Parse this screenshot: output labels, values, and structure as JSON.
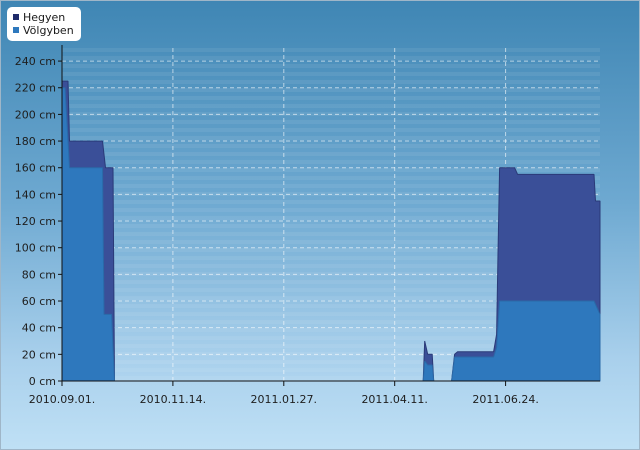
{
  "chart_data": {
    "type": "area",
    "x_ticks": [
      "2010.09.01.",
      "2010.11.14.",
      "2011.01.27.",
      "2011.04.11.",
      "2011.06.24."
    ],
    "y_ticks": [
      "0 cm",
      "20 cm",
      "40 cm",
      "60 cm",
      "80 cm",
      "100 cm",
      "120 cm",
      "140 cm",
      "160 cm",
      "180 cm",
      "200 cm",
      "220 cm",
      "240 cm"
    ],
    "ylim": [
      0,
      240
    ],
    "xlim": [
      "2010.09.01.",
      "2011.08.26."
    ],
    "legend_position": "top-left",
    "grid": true,
    "series": [
      {
        "name": "Hegyen",
        "color": "#3a4f98",
        "points": [
          [
            "2010.09.01.",
            225
          ],
          [
            "2010.09.05.",
            225
          ],
          [
            "2010.09.06.",
            180
          ],
          [
            "2010.09.28.",
            180
          ],
          [
            "2010.09.30.",
            160
          ],
          [
            "2010.10.05.",
            160
          ],
          [
            "2010.10.06.",
            0
          ],
          [
            "2011.04.30.",
            0
          ],
          [
            "2011.05.01.",
            30
          ],
          [
            "2011.05.03.",
            20
          ],
          [
            "2011.05.06.",
            20
          ],
          [
            "2011.05.07.",
            0
          ],
          [
            "2011.05.19.",
            0
          ],
          [
            "2011.05.21.",
            20
          ],
          [
            "2011.05.23.",
            22
          ],
          [
            "2011.06.16.",
            22
          ],
          [
            "2011.06.18.",
            35
          ],
          [
            "2011.06.19.",
            100
          ],
          [
            "2011.06.20.",
            160
          ],
          [
            "2011.06.30.",
            160
          ],
          [
            "2011.07.02.",
            155
          ],
          [
            "2011.08.22.",
            155
          ],
          [
            "2011.08.23.",
            135
          ],
          [
            "2011.08.26.",
            135
          ]
        ]
      },
      {
        "name": "Völgyben",
        "color": "#2e78bd",
        "points": [
          [
            "2010.09.01.",
            220
          ],
          [
            "2010.09.03.",
            220
          ],
          [
            "2010.09.06.",
            160
          ],
          [
            "2010.09.28.",
            160
          ],
          [
            "2010.09.29.",
            50
          ],
          [
            "2010.10.04.",
            50
          ],
          [
            "2010.10.06.",
            0
          ],
          [
            "2011.04.30.",
            0
          ],
          [
            "2011.05.01.",
            15
          ],
          [
            "2011.05.03.",
            12
          ],
          [
            "2011.05.06.",
            12
          ],
          [
            "2011.05.07.",
            0
          ],
          [
            "2011.05.19.",
            0
          ],
          [
            "2011.05.21.",
            18
          ],
          [
            "2011.06.16.",
            18
          ],
          [
            "2011.06.18.",
            25
          ],
          [
            "2011.06.20.",
            60
          ],
          [
            "2011.08.22.",
            60
          ],
          [
            "2011.08.26.",
            50
          ]
        ]
      }
    ]
  }
}
